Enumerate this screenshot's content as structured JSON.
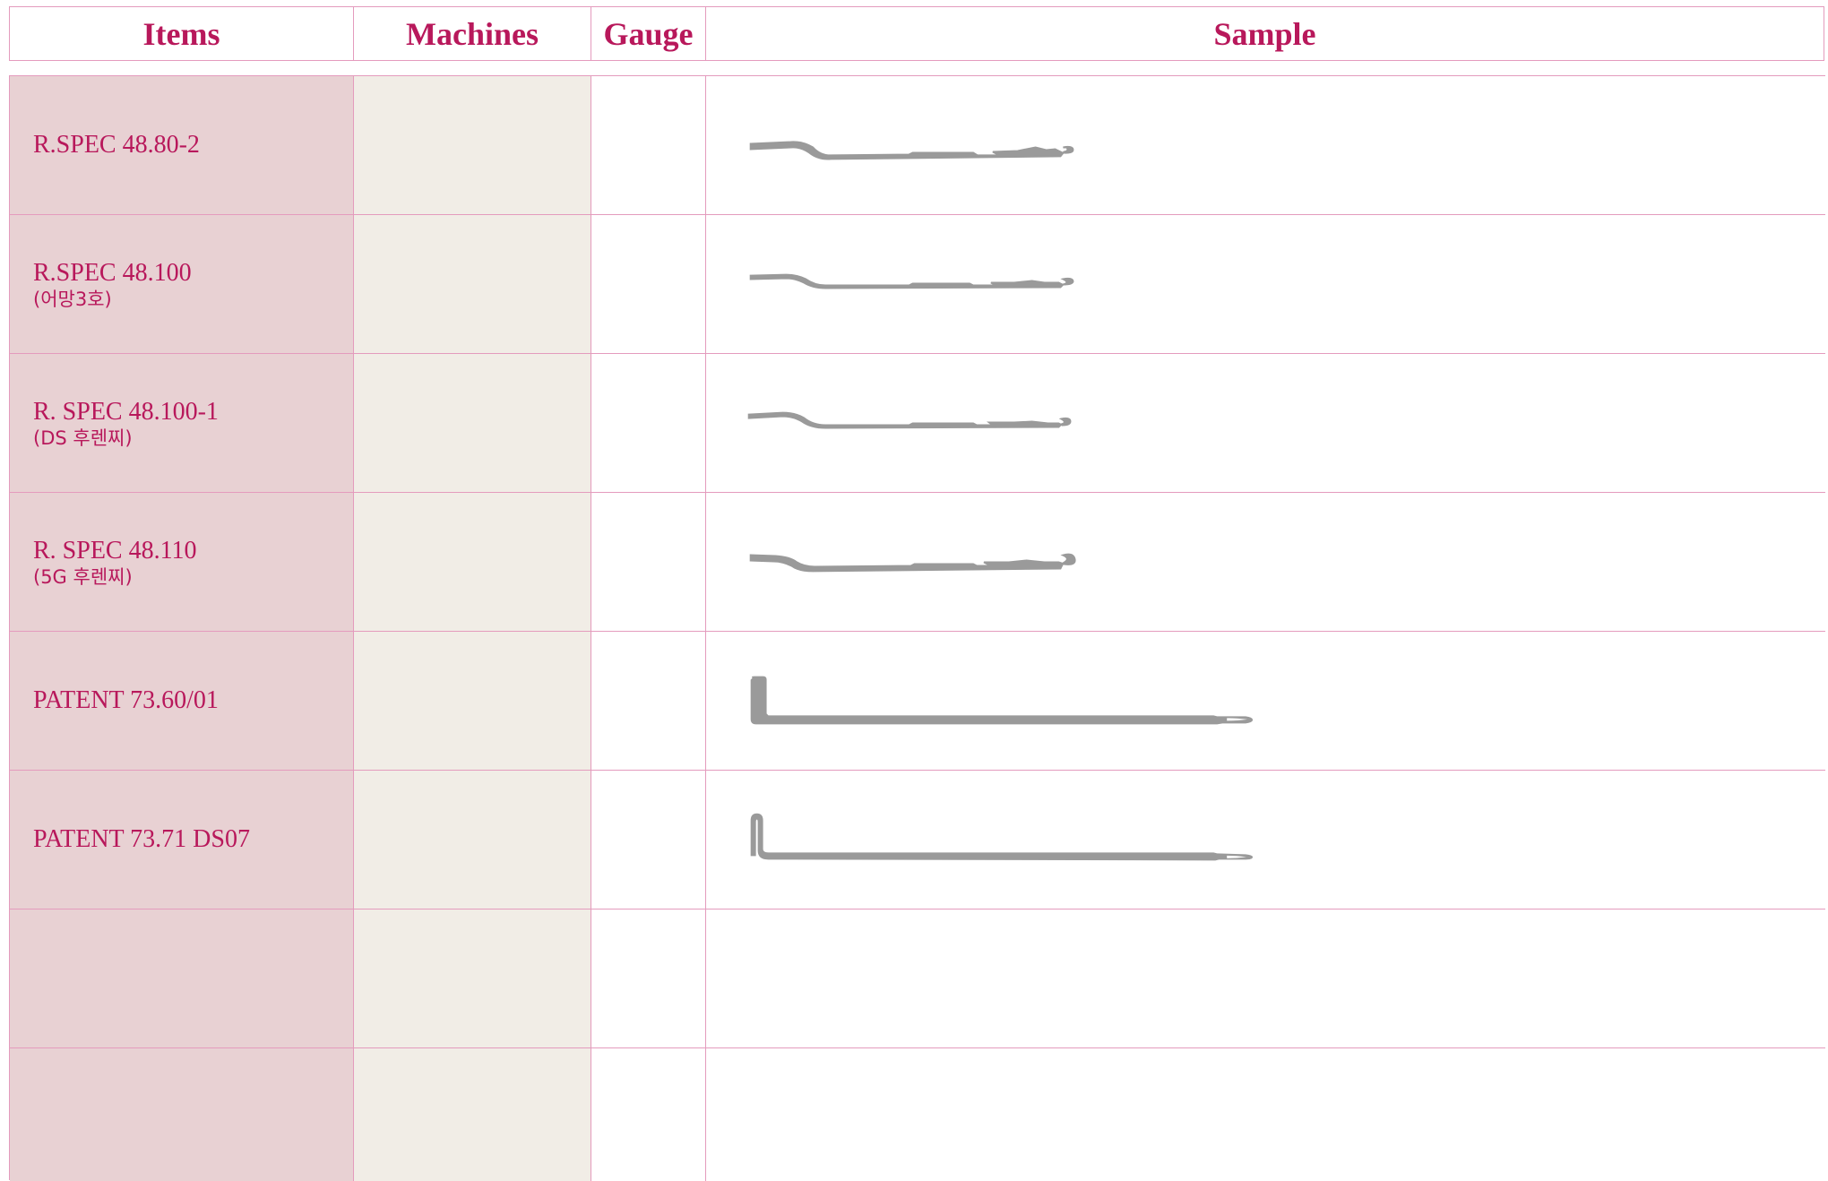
{
  "header": {
    "items": "Items",
    "machines": "Machines",
    "gauge": "Gauge",
    "sample": "Sample"
  },
  "rows": [
    {
      "name": "R.SPEC 48.80-2",
      "sub": "",
      "machine": "",
      "gauge": "",
      "sample": "latch-needle-sample"
    },
    {
      "name": "R.SPEC 48.100",
      "sub": "(어망3호)",
      "machine": "",
      "gauge": "",
      "sample": "latch-needle-sample"
    },
    {
      "name": "R. SPEC 48.100-1",
      "sub": "(DS 후렌찌)",
      "machine": "",
      "gauge": "",
      "sample": "latch-needle-sample"
    },
    {
      "name": "R. SPEC 48.110",
      "sub": "(5G 후렌찌)",
      "machine": "",
      "gauge": "",
      "sample": "latch-needle-sample"
    },
    {
      "name": "PATENT 73.60/01",
      "sub": "",
      "machine": "",
      "gauge": "",
      "sample": "patent-needle-sample"
    },
    {
      "name": "PATENT 73.71 DS07",
      "sub": "",
      "machine": "",
      "gauge": "",
      "sample": "patent-needle-thin-sample"
    },
    {
      "name": "",
      "sub": "",
      "machine": "",
      "gauge": "",
      "sample": ""
    },
    {
      "name": "",
      "sub": "",
      "machine": "",
      "gauge": "",
      "sample": ""
    }
  ],
  "colors": {
    "header_text": "#b8185b",
    "border": "#e49bbd",
    "items_bg": "#e8d1d3",
    "machines_bg": "#f1ede6",
    "needle": "#9a9a9a"
  }
}
